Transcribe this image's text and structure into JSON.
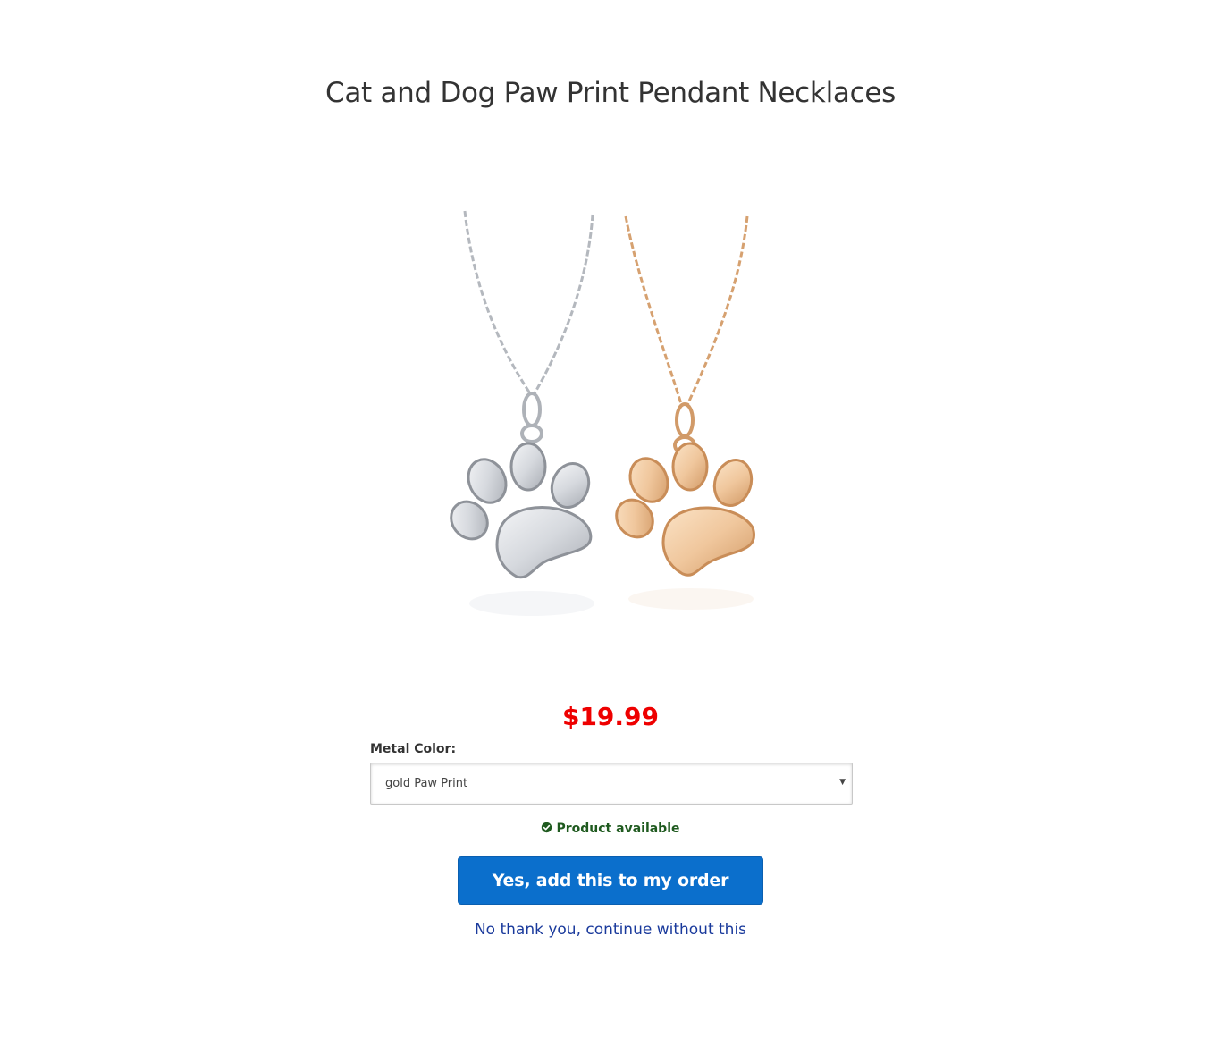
{
  "product": {
    "title": "Cat and Dog Paw Print Pendant Necklaces",
    "price": "$19.99",
    "variant_label": "Metal Color:",
    "variant_selected": "gold Paw Print",
    "availability": "Product available"
  },
  "actions": {
    "accept_label": "Yes, add this to my order $19.99",
    "decline_label": "No thank you, continue without this"
  },
  "icons": {
    "availability": "check-circle-icon",
    "select": "caret-down-icon"
  },
  "colors": {
    "price": "#ee0000",
    "button": "#0b6fcc",
    "available": "#1f5a1f",
    "link": "#1a3a9c",
    "silver": "#c9ccd1",
    "gold": "#e8b98d"
  }
}
